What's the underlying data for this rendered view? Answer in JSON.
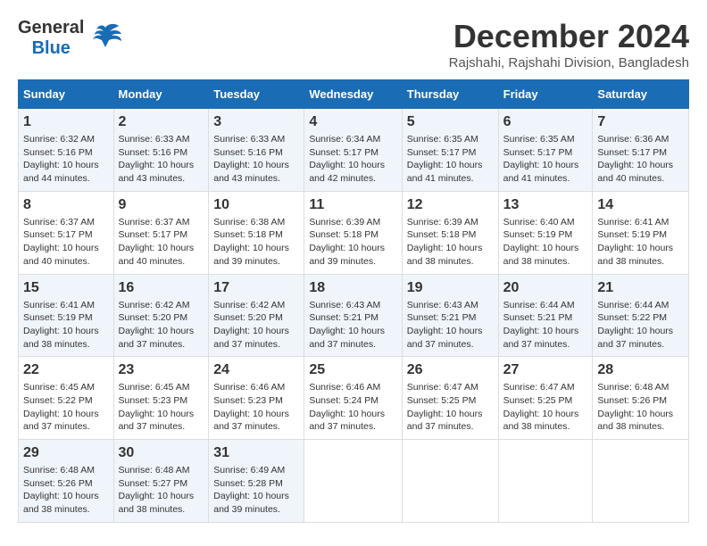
{
  "logo": {
    "general": "General",
    "blue": "Blue"
  },
  "title": "December 2024",
  "location": "Rajshahi, Rajshahi Division, Bangladesh",
  "headers": [
    "Sunday",
    "Monday",
    "Tuesday",
    "Wednesday",
    "Thursday",
    "Friday",
    "Saturday"
  ],
  "weeks": [
    [
      {
        "day": "1",
        "sunrise": "6:32 AM",
        "sunset": "5:16 PM",
        "daylight": "10 hours and 44 minutes."
      },
      {
        "day": "2",
        "sunrise": "6:33 AM",
        "sunset": "5:16 PM",
        "daylight": "10 hours and 43 minutes."
      },
      {
        "day": "3",
        "sunrise": "6:33 AM",
        "sunset": "5:16 PM",
        "daylight": "10 hours and 43 minutes."
      },
      {
        "day": "4",
        "sunrise": "6:34 AM",
        "sunset": "5:17 PM",
        "daylight": "10 hours and 42 minutes."
      },
      {
        "day": "5",
        "sunrise": "6:35 AM",
        "sunset": "5:17 PM",
        "daylight": "10 hours and 41 minutes."
      },
      {
        "day": "6",
        "sunrise": "6:35 AM",
        "sunset": "5:17 PM",
        "daylight": "10 hours and 41 minutes."
      },
      {
        "day": "7",
        "sunrise": "6:36 AM",
        "sunset": "5:17 PM",
        "daylight": "10 hours and 40 minutes."
      }
    ],
    [
      {
        "day": "8",
        "sunrise": "6:37 AM",
        "sunset": "5:17 PM",
        "daylight": "10 hours and 40 minutes."
      },
      {
        "day": "9",
        "sunrise": "6:37 AM",
        "sunset": "5:17 PM",
        "daylight": "10 hours and 40 minutes."
      },
      {
        "day": "10",
        "sunrise": "6:38 AM",
        "sunset": "5:18 PM",
        "daylight": "10 hours and 39 minutes."
      },
      {
        "day": "11",
        "sunrise": "6:39 AM",
        "sunset": "5:18 PM",
        "daylight": "10 hours and 39 minutes."
      },
      {
        "day": "12",
        "sunrise": "6:39 AM",
        "sunset": "5:18 PM",
        "daylight": "10 hours and 38 minutes."
      },
      {
        "day": "13",
        "sunrise": "6:40 AM",
        "sunset": "5:19 PM",
        "daylight": "10 hours and 38 minutes."
      },
      {
        "day": "14",
        "sunrise": "6:41 AM",
        "sunset": "5:19 PM",
        "daylight": "10 hours and 38 minutes."
      }
    ],
    [
      {
        "day": "15",
        "sunrise": "6:41 AM",
        "sunset": "5:19 PM",
        "daylight": "10 hours and 38 minutes."
      },
      {
        "day": "16",
        "sunrise": "6:42 AM",
        "sunset": "5:20 PM",
        "daylight": "10 hours and 37 minutes."
      },
      {
        "day": "17",
        "sunrise": "6:42 AM",
        "sunset": "5:20 PM",
        "daylight": "10 hours and 37 minutes."
      },
      {
        "day": "18",
        "sunrise": "6:43 AM",
        "sunset": "5:21 PM",
        "daylight": "10 hours and 37 minutes."
      },
      {
        "day": "19",
        "sunrise": "6:43 AM",
        "sunset": "5:21 PM",
        "daylight": "10 hours and 37 minutes."
      },
      {
        "day": "20",
        "sunrise": "6:44 AM",
        "sunset": "5:21 PM",
        "daylight": "10 hours and 37 minutes."
      },
      {
        "day": "21",
        "sunrise": "6:44 AM",
        "sunset": "5:22 PM",
        "daylight": "10 hours and 37 minutes."
      }
    ],
    [
      {
        "day": "22",
        "sunrise": "6:45 AM",
        "sunset": "5:22 PM",
        "daylight": "10 hours and 37 minutes."
      },
      {
        "day": "23",
        "sunrise": "6:45 AM",
        "sunset": "5:23 PM",
        "daylight": "10 hours and 37 minutes."
      },
      {
        "day": "24",
        "sunrise": "6:46 AM",
        "sunset": "5:23 PM",
        "daylight": "10 hours and 37 minutes."
      },
      {
        "day": "25",
        "sunrise": "6:46 AM",
        "sunset": "5:24 PM",
        "daylight": "10 hours and 37 minutes."
      },
      {
        "day": "26",
        "sunrise": "6:47 AM",
        "sunset": "5:25 PM",
        "daylight": "10 hours and 37 minutes."
      },
      {
        "day": "27",
        "sunrise": "6:47 AM",
        "sunset": "5:25 PM",
        "daylight": "10 hours and 38 minutes."
      },
      {
        "day": "28",
        "sunrise": "6:48 AM",
        "sunset": "5:26 PM",
        "daylight": "10 hours and 38 minutes."
      }
    ],
    [
      {
        "day": "29",
        "sunrise": "6:48 AM",
        "sunset": "5:26 PM",
        "daylight": "10 hours and 38 minutes."
      },
      {
        "day": "30",
        "sunrise": "6:48 AM",
        "sunset": "5:27 PM",
        "daylight": "10 hours and 38 minutes."
      },
      {
        "day": "31",
        "sunrise": "6:49 AM",
        "sunset": "5:28 PM",
        "daylight": "10 hours and 39 minutes."
      },
      null,
      null,
      null,
      null
    ]
  ]
}
